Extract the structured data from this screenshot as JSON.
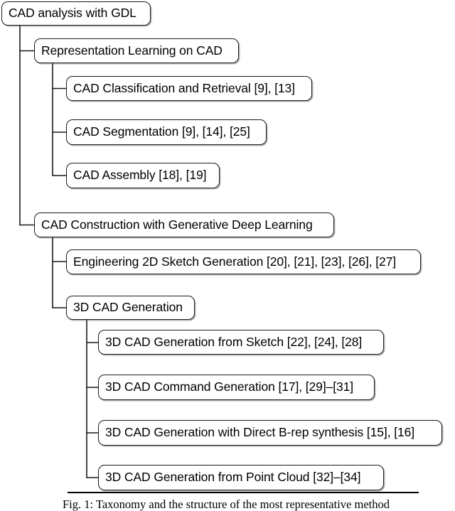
{
  "figure": {
    "caption": "Fig. 1: Taxonomy and the structure of the most representative method",
    "root_label": "CAD analysis with GDL",
    "stroke_color": "#1b1b1b",
    "background_color": "#ffffff",
    "text_color": "#000000"
  },
  "nodes": {
    "root": {
      "label": "CAD analysis with GDL"
    },
    "representation_learning": {
      "label": "Representation Learning on CAD"
    },
    "cad_classification_retrieval": {
      "label": "CAD Classification and Retrieval [9], [13]"
    },
    "cad_segmentation": {
      "label": "CAD Segmentation [9], [14], [25]"
    },
    "cad_assembly": {
      "label": "CAD Assembly [18], [19]"
    },
    "cad_construction": {
      "label": "CAD Construction with Generative Deep Learning"
    },
    "sketch_generation_2d": {
      "label": "Engineering 2D Sketch Generation [20], [21], [23], [26], [27]"
    },
    "cad_generation_3d": {
      "label": "3D CAD Generation"
    },
    "generation_from_sketch": {
      "label": "3D CAD Generation from Sketch [22], [24], [28]"
    },
    "command_generation": {
      "label": "3D CAD Command Generation [17], [29]–[31]"
    },
    "direct_brep_synthesis": {
      "label": "3D CAD Generation with Direct B-rep synthesis [15], [16]"
    },
    "generation_from_point_cloud": {
      "label": "3D CAD Generation from Point Cloud [32]–[34]"
    }
  },
  "chart_data": {
    "type": "diagram",
    "diagram_type": "tree-taxonomy",
    "title": "Taxonomy and the structure of the most representative method",
    "orientation": "left-to-right indented tree",
    "tree": {
      "label": "CAD analysis with GDL",
      "level": 1,
      "children": [
        {
          "label": "Representation Learning on CAD",
          "level": 2,
          "children": [
            {
              "label": "CAD Classification and Retrieval [9], [13]",
              "level": 3,
              "references": [
                "9",
                "13"
              ]
            },
            {
              "label": "CAD Segmentation [9], [14], [25]",
              "level": 3,
              "references": [
                "9",
                "14",
                "25"
              ]
            },
            {
              "label": "CAD Assembly [18], [19]",
              "level": 3,
              "references": [
                "18",
                "19"
              ]
            }
          ]
        },
        {
          "label": "CAD Construction with Generative Deep Learning",
          "level": 2,
          "children": [
            {
              "label": "Engineering 2D Sketch Generation [20], [21], [23], [26], [27]",
              "level": 3,
              "references": [
                "20",
                "21",
                "23",
                "26",
                "27"
              ]
            },
            {
              "label": "3D CAD Generation",
              "level": 3,
              "children": [
                {
                  "label": "3D CAD Generation from Sketch [22], [24], [28]",
                  "level": 4,
                  "references": [
                    "22",
                    "24",
                    "28"
                  ]
                },
                {
                  "label": "3D CAD Command Generation [17], [29]–[31]",
                  "level": 4,
                  "references": [
                    "17",
                    "29-31"
                  ]
                },
                {
                  "label": "3D CAD Generation with Direct B-rep synthesis [15], [16]",
                  "level": 4,
                  "references": [
                    "15",
                    "16"
                  ]
                },
                {
                  "label": "3D CAD Generation from Point Cloud [32]–[34]",
                  "level": 4,
                  "references": [
                    "32-34"
                  ]
                }
              ]
            }
          ]
        }
      ]
    }
  }
}
